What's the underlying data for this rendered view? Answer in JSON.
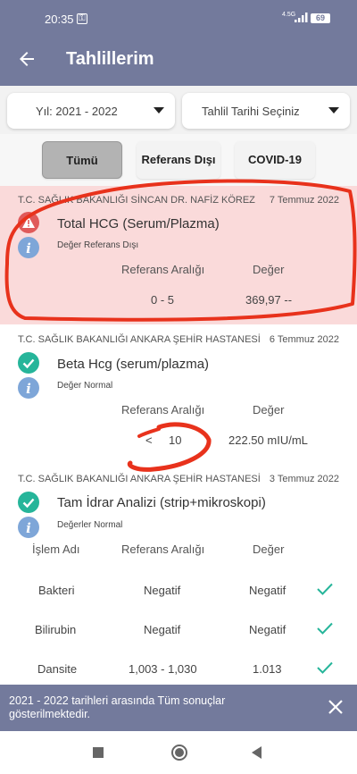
{
  "statusbar": {
    "time": "20:35",
    "network": "4.5G",
    "battery": "69"
  },
  "appbar": {
    "title": "Tahlillerim"
  },
  "filters": {
    "year": "Yıl: 2021 - 2022",
    "date": "Tahlil Tarihi Seçiniz"
  },
  "tabs": {
    "all": "Tümü",
    "out_of_ref": "Referans Dışı",
    "covid": "COVID-19"
  },
  "results": [
    {
      "hospital": "T.C. SAĞLIK BAKANLIĞI SİNCAN DR. NAFİZ KÖREZ",
      "date": "7 Temmuz 2022",
      "test": "Total HCG (Serum/Plazma)",
      "status": "Değer Referans Dışı",
      "ref_head": "Referans Aralığı",
      "val_head": "Değer",
      "ref": "0 - 5",
      "value": "369,97 --",
      "alert": true
    },
    {
      "hospital": "T.C. SAĞLIK BAKANLIĞI ANKARA ŞEHİR HASTANESİ",
      "date": "6 Temmuz 2022",
      "test": "Beta Hcg (serum/plazma)",
      "status": "Değer Normal",
      "ref_head": "Referans Aralığı",
      "val_head": "Değer",
      "ref_prefix": "<",
      "ref": "10",
      "value": "222.50 mIU/mL"
    },
    {
      "hospital": "T.C. SAĞLIK BAKANLIĞI ANKARA ŞEHİR HASTANESİ",
      "date": "3 Temmuz 2022",
      "test": "Tam İdrar Analizi (strip+mikroskopi)",
      "status": "Değerler Normal",
      "name_head": "İşlem Adı",
      "ref_head": "Referans Aralığı",
      "val_head": "Değer",
      "rows": [
        {
          "name": "Bakteri",
          "ref": "Negatif",
          "value": "Negatif"
        },
        {
          "name": "Bilirubin",
          "ref": "Negatif",
          "value": "Negatif"
        },
        {
          "name": "Dansite",
          "ref": "1,003 - 1,030",
          "value": "1.013"
        }
      ]
    }
  ],
  "snackbar": {
    "message": "2021 - 2022 tarihleri arasında Tüm sonuçlar gösterilmektedir."
  },
  "colors": {
    "primary": "#737a9c",
    "alert_bg": "#fadada",
    "alert_red": "#e05a5a",
    "ok_green": "#26b59a",
    "info_blue": "#7ea6d8"
  }
}
